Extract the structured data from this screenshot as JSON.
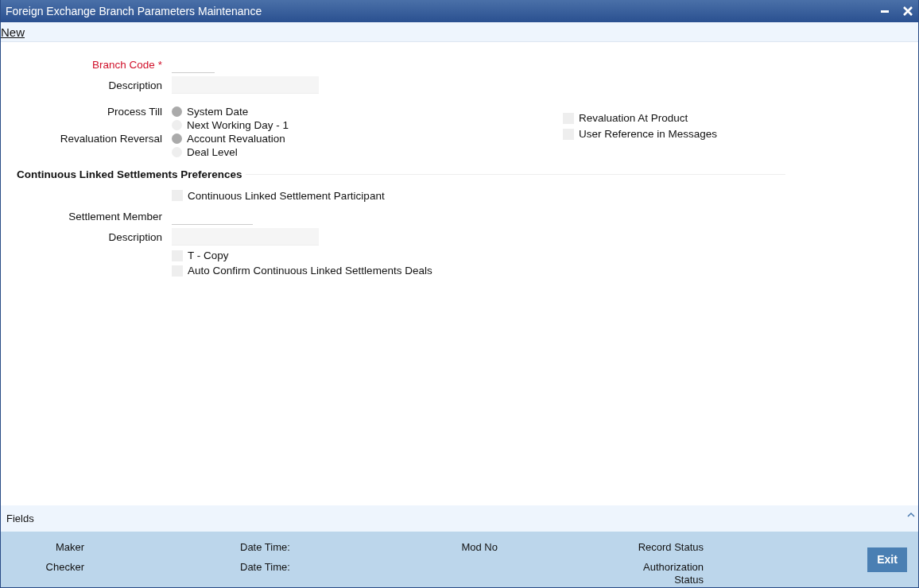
{
  "window": {
    "title": "Foreign Exchange Branch Parameters Maintenance"
  },
  "toolbar": {
    "new_link": "New"
  },
  "form": {
    "branch_code": {
      "label": "Branch Code",
      "required_mark": "*"
    },
    "description": {
      "label": "Description"
    },
    "process_till": {
      "label": "Process Till",
      "options": [
        {
          "label": "System Date",
          "selected": true
        },
        {
          "label": "Next Working Day - 1",
          "selected": false
        }
      ]
    },
    "revaluation_reversal": {
      "label": "Revaluation Reversal",
      "options": [
        {
          "label": "Account Revaluation",
          "selected": true
        },
        {
          "label": "Deal Level",
          "selected": false
        }
      ]
    },
    "options": [
      {
        "label": "Revaluation At Product",
        "checked": false
      },
      {
        "label": "User Reference in Messages",
        "checked": false
      }
    ]
  },
  "cls_section": {
    "title": "Continuous Linked Settlements Preferences",
    "participant": {
      "label": "Continuous Linked Settlement Participant",
      "checked": false
    },
    "settlement_member": {
      "label": "Settlement Member"
    },
    "description": {
      "label": "Description"
    },
    "options": [
      {
        "label": "T - Copy",
        "checked": false
      },
      {
        "label": "Auto Confirm Continuous Linked Settlements Deals",
        "checked": false
      }
    ]
  },
  "fields_bar": {
    "label": "Fields"
  },
  "audit": {
    "maker": "Maker",
    "maker_date_time": "Date Time:",
    "mod_no": "Mod No",
    "record_status": "Record Status",
    "checker": "Checker",
    "checker_date_time": "Date Time:",
    "authorization_status": "Authorization Status"
  },
  "buttons": {
    "exit": "Exit"
  }
}
